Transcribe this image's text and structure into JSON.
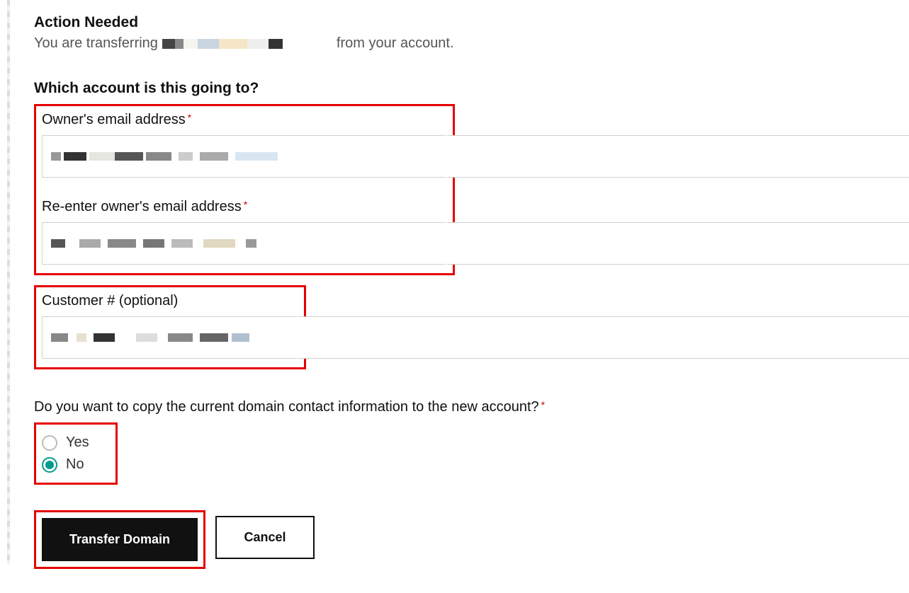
{
  "header": {
    "title": "Action Needed",
    "prefix": "You are transferring",
    "suffix": "from your account."
  },
  "section": {
    "which_account": "Which account is this going to?"
  },
  "fields": {
    "owner_email": {
      "label": "Owner's email address"
    },
    "reenter_email": {
      "label": "Re-enter owner's email address"
    },
    "customer_number": {
      "label": "Customer # (optional)"
    }
  },
  "copy_contact": {
    "question": "Do you want to copy the current domain contact information to the new account?",
    "yes": "Yes",
    "no": "No",
    "selected": "no"
  },
  "buttons": {
    "transfer": "Transfer Domain",
    "cancel": "Cancel"
  }
}
